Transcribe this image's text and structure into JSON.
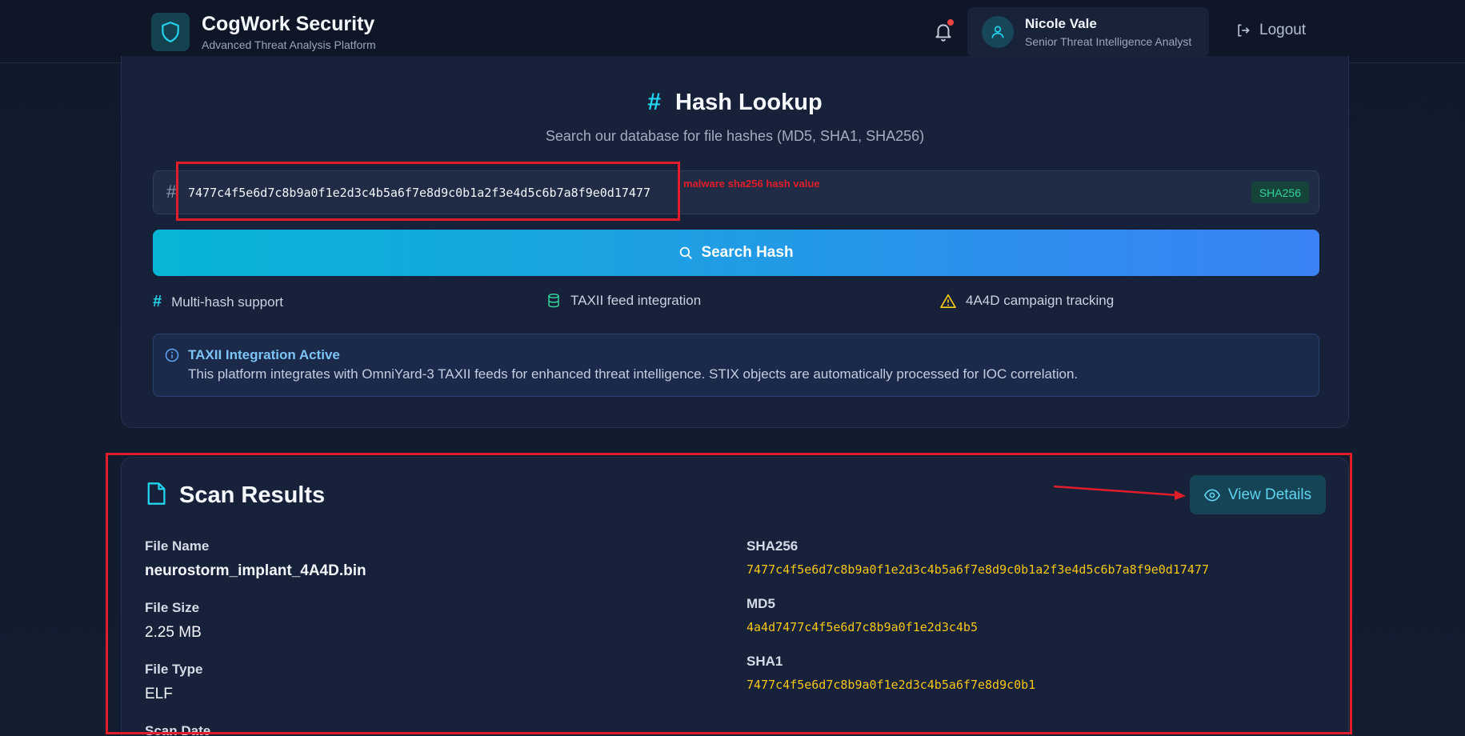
{
  "header": {
    "brand_title": "CogWork Security",
    "brand_subtitle": "Advanced Threat Analysis Platform",
    "user_name": "Nicole Vale",
    "user_role": "Senior Threat Intelligence Analyst",
    "logout_label": "Logout"
  },
  "lookup": {
    "title": "Hash Lookup",
    "subtitle": "Search our database for file hashes (MD5, SHA1, SHA256)",
    "input_prefix": "#",
    "input_value": "7477c4f5e6d7c8b9a0f1e2d3c4b5a6f7e8d9c0b1a2f3e4d5c6b7a8f9e0d17477",
    "hash_type_badge": "SHA256",
    "search_button_label": "Search Hash",
    "features": [
      {
        "label": "Multi-hash support",
        "icon": "hash-icon"
      },
      {
        "label": "TAXII feed integration",
        "icon": "database-icon"
      },
      {
        "label": "4A4D campaign tracking",
        "icon": "warning-icon"
      }
    ],
    "info": {
      "title": "TAXII Integration Active",
      "text": "This platform integrates with OmniYard-3 TAXII feeds for enhanced threat intelligence. STIX objects are automatically processed for IOC correlation."
    }
  },
  "results": {
    "title": "Scan Results",
    "view_details_label": "View Details",
    "fields": {
      "file_name_label": "File Name",
      "file_name_value": "neurostorm_implant_4A4D.bin",
      "file_size_label": "File Size",
      "file_size_value": "2.25 MB",
      "file_type_label": "File Type",
      "file_type_value": "ELF",
      "scan_date_label": "Scan Date"
    },
    "hashes": {
      "sha256_label": "SHA256",
      "sha256_value": "7477c4f5e6d7c8b9a0f1e2d3c4b5a6f7e8d9c0b1a2f3e4d5c6b7a8f9e0d17477",
      "md5_label": "MD5",
      "md5_value": "4a4d7477c4f5e6d7c8b9a0f1e2d3c4b5",
      "sha1_label": "SHA1",
      "sha1_value": "7477c4f5e6d7c8b9a0f1e2d3c4b5a6f7e8d9c0b1"
    }
  },
  "annotations": {
    "hash_note": "malware sha256 hash value"
  },
  "colors": {
    "accent_cyan": "#22d3ee",
    "accent_blue": "#3b82f6",
    "hash_yellow": "#f5c518",
    "annotation_red": "#e11d2a"
  }
}
